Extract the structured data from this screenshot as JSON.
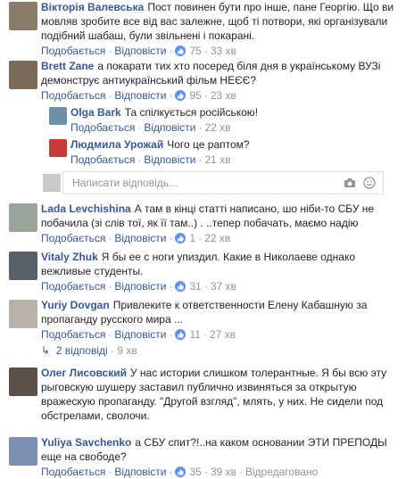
{
  "labels": {
    "like": "Подобається",
    "reply": "Відповісти"
  },
  "comments": [
    {
      "name": "Вікторія Валевська",
      "text": "Пост повинен бути про інше, пане Георгію. Що ви мовляв зробите все від вас залежне, щоб ті потвори, які організували подібний шабаш, були звільнені і покарані.",
      "likes": "75",
      "time": "33 хв",
      "avatar_color": "#8a7c6d"
    },
    {
      "name": "Brett Zane",
      "text": "а покарати тих хто посеред біля дня в українському ВУЗі демонструє антиукраїнський фільм НЕЄЄ?",
      "likes": "95",
      "time": "23 хв",
      "avatar_color": "#7a6a5a"
    }
  ],
  "replies": [
    {
      "name": "Olga Bark",
      "text": "Та спілкується російською!",
      "likes": "",
      "time": "22 хв",
      "avatar_color": "#6d8fa8"
    },
    {
      "name": "Людмила Урожай",
      "text": "Чого це раптом?",
      "likes": "",
      "time": "21 хв",
      "avatar_color": "#c83a3a"
    }
  ],
  "reply_input": {
    "placeholder": "Написати відповідь..."
  },
  "comments2": [
    {
      "name": "Lada Levchishina",
      "text": "А там в кінці статті написано, шо ніби-то СБУ не побачила (зі слів тої, як її там..) . ..тепер побачать, маємо надію",
      "likes": "1",
      "time": "22 хв",
      "avatar_color": "#9aa59a"
    },
    {
      "name": "Vitaly Zhuk",
      "text": "Я бы ее с ноги упиздил. Какие в Николаеве однако вежливые студенты.",
      "likes": "31",
      "time": "37 хв",
      "avatar_color": "#55606b"
    },
    {
      "name": "Yuriy Dovgan",
      "text": "Привлеките к ответственности Елену Кабашную за пропаганду русского мира ...",
      "likes": "11",
      "time": "27 хв",
      "avatar_color": "#b8b2a8"
    }
  ],
  "more_replies": {
    "label": "2 відповіді",
    "time": "9 хв"
  },
  "comments3": [
    {
      "name": "Олег Лисовский",
      "text": "У нас истории слишком толерантные. Я бы всю эту рыговскую шушеру заставил публично извиняться за открытую вражескую пропаганду. \"Другой взгляд\", млять, у них. Не сидели под обстрелами, сволочи.",
      "likes": "",
      "time": "",
      "avatar_color": "#5c5148"
    },
    {
      "name": "Yuliya Savchenko",
      "text": "а СБУ спит?!..на каком основании ЭТИ ПРЕПОДЫ еще на свободе?",
      "likes": "35",
      "time": "39 хв",
      "edited": "Відредаговано",
      "avatar_color": "#7d8fb3"
    }
  ]
}
